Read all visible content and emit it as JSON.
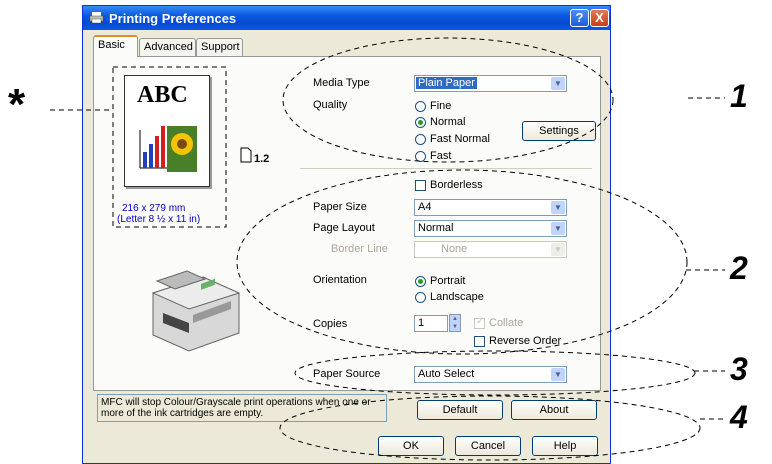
{
  "window": {
    "title": "Printing Preferences",
    "help_glyph": "?",
    "close_glyph": "X"
  },
  "tabs": [
    "Basic",
    "Advanced",
    "Support"
  ],
  "preview": {
    "abc": "ABC",
    "size_mm": "216 x 279 mm",
    "size_in": "(Letter 8 ½ x 11 in)",
    "pages_label": "1.2"
  },
  "media": {
    "media_type_label": "Media Type",
    "media_type_value": "Plain Paper",
    "quality_label": "Quality",
    "quality_options": [
      "Fine",
      "Normal",
      "Fast Normal",
      "Fast"
    ],
    "selected_quality": "Normal",
    "settings_button": "Settings"
  },
  "layout": {
    "borderless_label": "Borderless",
    "paper_size_label": "Paper Size",
    "paper_size_value": "A4",
    "page_layout_label": "Page Layout",
    "page_layout_value": "Normal",
    "border_line_label": "Border Line",
    "border_line_value": "None",
    "orientation_label": "Orientation",
    "orientation_options": [
      "Portrait",
      "Landscape"
    ],
    "selected_orientation": "Portrait",
    "copies_label": "Copies",
    "copies_value": "1",
    "collate_label": "Collate",
    "reverse_order_label": "Reverse Order"
  },
  "source": {
    "paper_source_label": "Paper Source",
    "paper_source_value": "Auto Select"
  },
  "info_text": "MFC will stop Colour/Grayscale print operations when one or more of the ink cartridges are empty.",
  "buttons": {
    "default": "Default",
    "about": "About",
    "ok": "OK",
    "cancel": "Cancel",
    "help": "Help"
  },
  "annotations": {
    "star": "*",
    "one": "1",
    "two": "2",
    "three": "3",
    "four": "4"
  },
  "colors": {
    "titlebar": "#0a5ade",
    "accent_tab": "#e68b2c",
    "selection": "#316ac5"
  }
}
